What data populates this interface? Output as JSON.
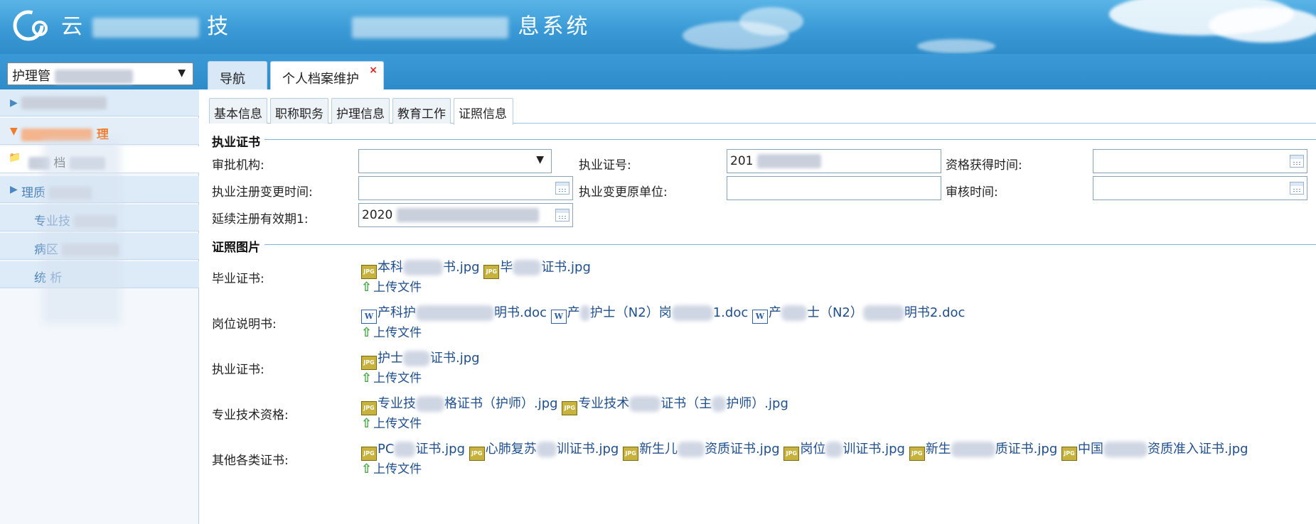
{
  "header": {
    "app_title_left": "云",
    "app_title_left_tail": "技",
    "app_title_tail": "息系统"
  },
  "topbar": {
    "module_select_value": "护理管",
    "tabs": [
      {
        "label": "导航"
      },
      {
        "label": "个人档案维护",
        "close": "×"
      }
    ]
  },
  "sidebar": {
    "items": [
      {
        "label": ""
      },
      {
        "label": "理"
      },
      {
        "label": "档"
      },
      {
        "label": "理质"
      },
      {
        "label": "专业技"
      },
      {
        "label": "病区"
      },
      {
        "label": "统  析"
      }
    ]
  },
  "subtabs": [
    "基本信息",
    "职称职务",
    "护理信息",
    "教育工作",
    "证照信息"
  ],
  "license_section": {
    "title": "执业证书",
    "fields": {
      "approval_org_label": "审批机构:",
      "license_no_label": "执业证号:",
      "license_no_value": "201",
      "qualify_time_label": "资格获得时间:",
      "reg_change_time_label": "执业注册变更时间:",
      "change_orig_unit_label": "执业变更原单位:",
      "audit_time_label": "审核时间:",
      "renew_valid_label": "延续注册有效期1:",
      "renew_valid_value": "2020"
    }
  },
  "photo_section": {
    "title": "证照图片",
    "upload_label": "上传文件",
    "rows": [
      {
        "label": "毕业证书:",
        "files": [
          "本科",
          "书.jpg",
          "毕",
          "证书.jpg"
        ]
      },
      {
        "label": "岗位说明书:",
        "files": [
          "产科护",
          "明书.doc",
          "产",
          "护士（N2）岗",
          "1.doc",
          "产",
          "士（N2）",
          "明书2.doc"
        ]
      },
      {
        "label": "执业证书:",
        "files": [
          "护士",
          "证书.jpg"
        ]
      },
      {
        "label": "专业技术资格:",
        "files": [
          "专业技",
          "格证书（护师）.jpg",
          "专业技术",
          "证书（主",
          "护师）.jpg"
        ]
      },
      {
        "label": "其他各类证书:",
        "files": [
          "PC",
          "证书.jpg",
          "心肺复苏",
          "训证书.jpg",
          "新生儿",
          "资质证书.jpg",
          "岗位",
          "训证书.jpg",
          "新生",
          "质证书.jpg",
          "中国",
          "资质准入证书.jpg"
        ]
      }
    ]
  }
}
